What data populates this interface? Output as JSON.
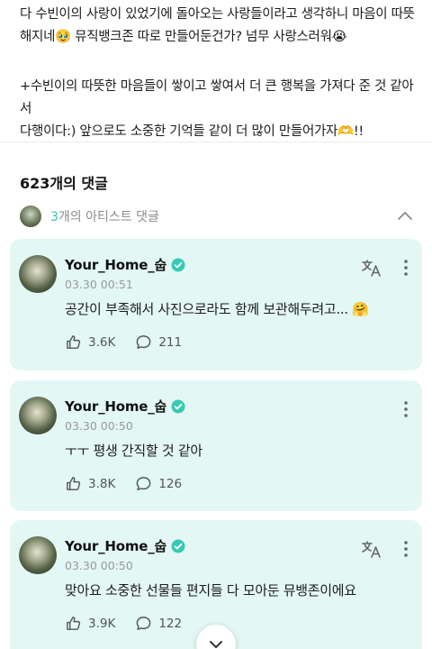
{
  "post": {
    "paragraph1_line1": "다 수빈이의 사랑이 있었기에 돌아오는 사랑들이라고 생각하니  마음이 따뜻",
    "paragraph1_line2": "해지네🥹 뮤직뱅크존 따로 만들어둔건가? 넘무 사랑스러워😭",
    "paragraph2_line1": "+수빈이의 따뜻한 마음들이 쌓이고 쌓여서 더 큰 행복을 가져다 준 것 같아서",
    "paragraph2_line2": "다행이다:) 앞으로도 소중한 기억들 같이 더 많이 만들어가자🫶!!"
  },
  "comments_header": {
    "count_label": "623개의 댓글",
    "artist_count": "3",
    "artist_label": "개의 아티스트 댓글"
  },
  "comments": [
    {
      "author": "Your_Home_숩",
      "date": "03.30 00:51",
      "text": "공간이 부족해서 사진으로라도 함께 보관해두려고... 🤗",
      "likes": "3.6K",
      "replies": "211"
    },
    {
      "author": "Your_Home_숩",
      "date": "03.30 00:50",
      "text": "ㅜㅜ 평생 간직할 것 같아",
      "likes": "3.8K",
      "replies": "126"
    },
    {
      "author": "Your_Home_숩",
      "date": "03.30 00:50",
      "text": "맞아요 소중한 선물들 편지들 다 모아둔 뮤뱅존이에요",
      "likes": "3.9K",
      "replies": "122"
    }
  ],
  "colors": {
    "accent": "#36c6b3",
    "card_background": "#e3f7f4",
    "verified_badge": "#38c9b4"
  },
  "icons": {
    "collapse": "chevron-up-icon",
    "verified": "verified-badge-icon",
    "translate": "translate-icon",
    "more": "more-vertical-icon",
    "like": "like-icon",
    "reply": "comment-icon",
    "scroll": "chevron-down-icon"
  }
}
